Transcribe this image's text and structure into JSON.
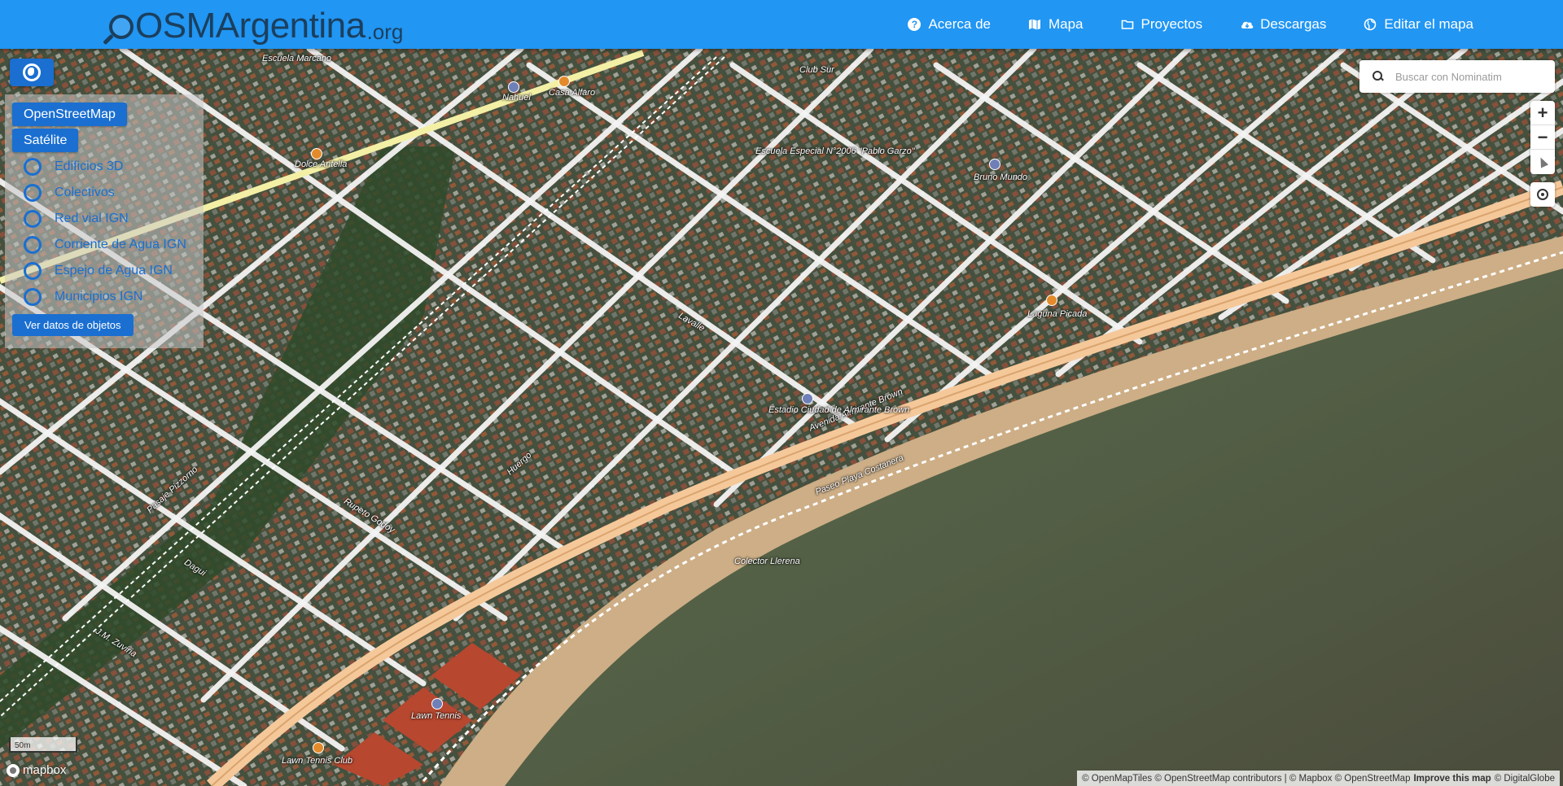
{
  "navbar": {
    "logo": {
      "main": "OSMArgentina",
      "suffix": ".org"
    },
    "items": [
      {
        "label": "Acerca de",
        "icon": "help-circle-icon"
      },
      {
        "label": "Mapa",
        "icon": "map-icon"
      },
      {
        "label": "Proyectos",
        "icon": "folder-icon"
      },
      {
        "label": "Descargas",
        "icon": "cloud-download-icon"
      },
      {
        "label": "Editar el mapa",
        "icon": "globe-icon"
      }
    ]
  },
  "layers": {
    "base": [
      "OpenStreetMap",
      "Satélite"
    ],
    "overlays": [
      "Edificios 3D",
      "Colectivos",
      "Red vial IGN",
      "Corriente de Agua IGN",
      "Espejo de Agua IGN",
      "Municipios IGN"
    ],
    "data_button": "Ver datos de objetos"
  },
  "search": {
    "placeholder": "Buscar con Nominatim"
  },
  "zoom": {
    "in": "+",
    "out": "−"
  },
  "scale": {
    "label": "50m"
  },
  "mapbox_logo": "mapbox",
  "attribution": {
    "part1": "© OpenMapTiles © OpenStreetMap contributors | © Mapbox © OpenStreetMap",
    "improve": "Improve this map",
    "part2": "© DigitalGlobe"
  },
  "map_labels": {
    "l1": "Escuela Marcano",
    "l2": "Nahuel",
    "l3": "Casa Alfaro",
    "l4": "Club Sur",
    "l5": "Dolce Antella",
    "l6": "Escuela Especial N°2006 \"Pablo Garzo\"",
    "l7": "Bruno Mundo",
    "l8": "Laguna Picada",
    "l9": "Avenida Almirante Brown",
    "l10": "Estadio Ciudad de Almirante Brown",
    "l11": "Paseo Playa Costanera",
    "l12": "Colector Llerena",
    "l13": "Lawn Tennis",
    "l14": "Lawn Tennis Club",
    "l15": "Rupeto Godoy",
    "l16": "Dagui",
    "l17": "J.M. Zuviria",
    "l18": "Pasaje Pizzorno",
    "l19": "Huergo",
    "l20": "Lavalle"
  }
}
